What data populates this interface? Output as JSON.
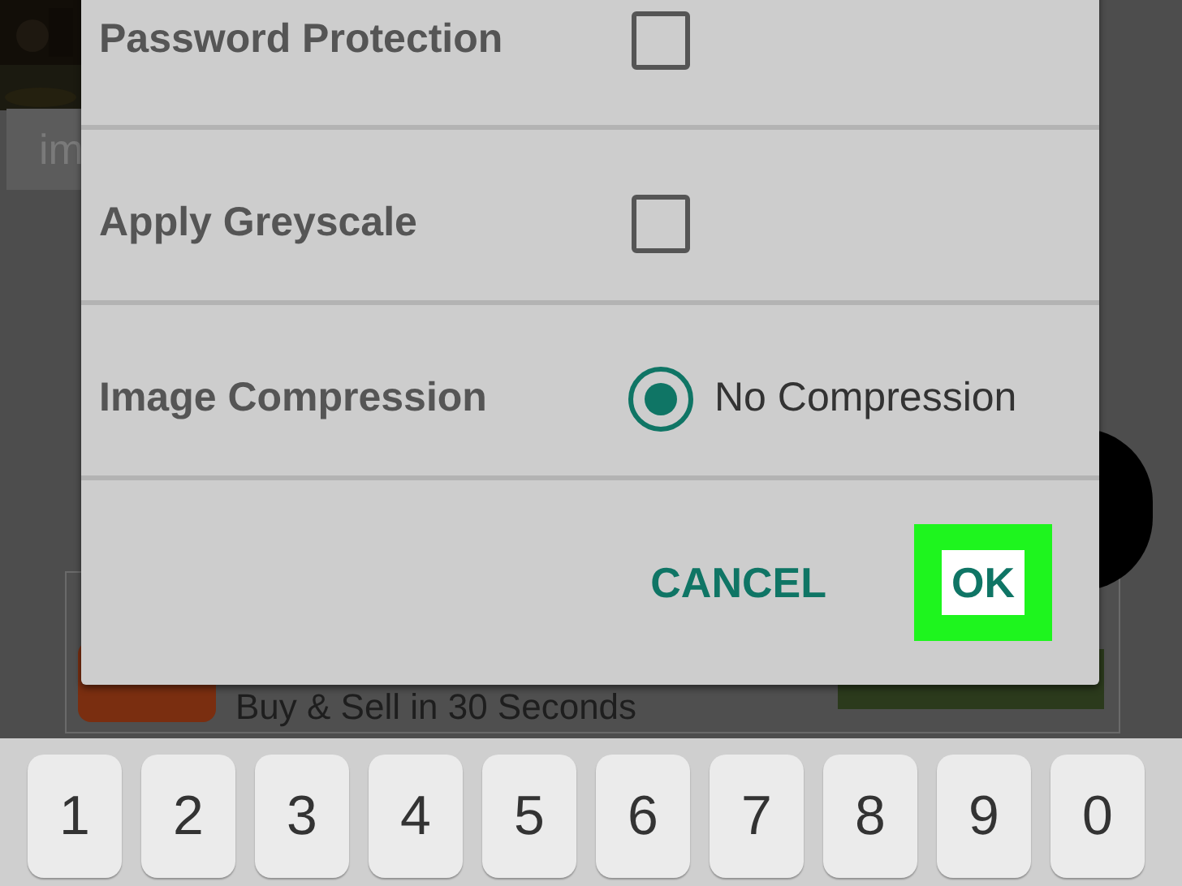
{
  "background": {
    "tile_label": "im",
    "ad_text": "Buy & Sell in 30 Seconds"
  },
  "dialog": {
    "options": [
      {
        "kind": "checkbox",
        "label": "Password Protection",
        "checked": false
      },
      {
        "kind": "checkbox",
        "label": "Apply Greyscale",
        "checked": false
      },
      {
        "kind": "radio",
        "label": "Image Compression",
        "value": "No Compression",
        "selected": true
      }
    ],
    "buttons": [
      {
        "label": "CANCEL",
        "highlighted": false
      },
      {
        "label": "OK",
        "highlighted": true
      }
    ]
  },
  "keyboard": {
    "keys": [
      "1",
      "2",
      "3",
      "4",
      "5",
      "6",
      "7",
      "8",
      "9",
      "0"
    ]
  }
}
